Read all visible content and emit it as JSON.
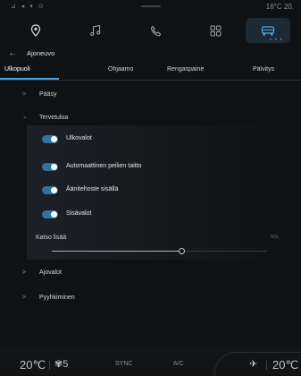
{
  "status": {
    "left_icons": "⊿ ◂ ▾ ⊙",
    "temperature": "16°C  20."
  },
  "topnav": {
    "items": [
      "location-icon",
      "music-icon",
      "phone-icon",
      "apps-icon",
      "car-icon"
    ],
    "active": "car-icon",
    "dots": "• • •"
  },
  "header": {
    "back": "←",
    "title": "Ajoneuvo"
  },
  "tabs": [
    "Ulkopuoli",
    "Ohjaamo",
    "Rengaspaine",
    "Päivitys"
  ],
  "sections": {
    "paasy": "Pääsy",
    "tervetuloa": "Tervetuloa",
    "ajovalot": "Ajovalot",
    "pyyhkiminen": "Pyyhkiminen"
  },
  "chevron_closed": ">",
  "chevron_open": "⌄",
  "toggles": [
    {
      "label": "Ulkovalot",
      "on": true
    },
    {
      "label": "Automaattinen peilien taitto",
      "on": true
    },
    {
      "label": "Äänitehoste sisällä",
      "on": true
    },
    {
      "label": "Sisävalot",
      "on": true
    }
  ],
  "slider": {
    "label": "Katso lisää",
    "value_text": "60s",
    "fraction": 0.6
  },
  "bottom": {
    "left_temp": "20℃",
    "fan_level": "5",
    "fan_icon": "✾",
    "sync": "SYNC",
    "ac": "A/C",
    "seat_icon": "✈",
    "right_temp": "20℃"
  },
  "colors": {
    "accent": "#49a3e3",
    "toggle_on": "#2f72a8",
    "background": "#0f1113"
  }
}
